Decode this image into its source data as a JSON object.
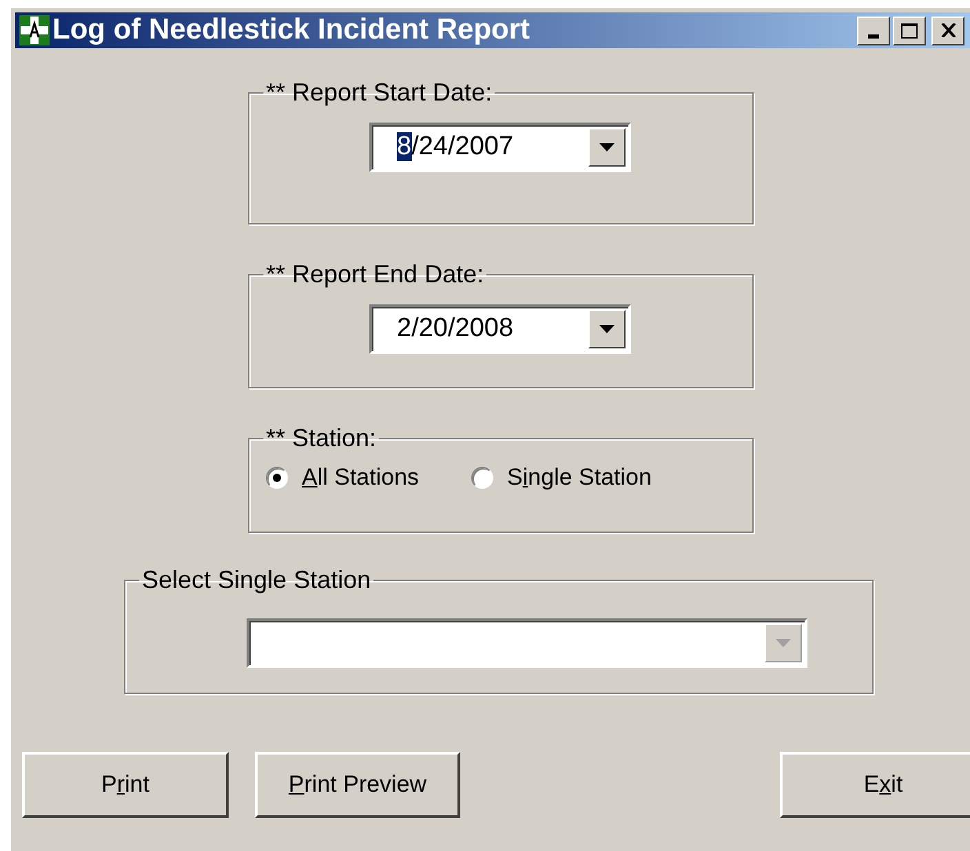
{
  "window": {
    "title": "Log of Needlestick Incident Report",
    "controls": [
      {
        "kind": "minimize"
      },
      {
        "kind": "maximize"
      },
      {
        "kind": "close"
      }
    ]
  },
  "start_date": {
    "label": "** Report Start Date:",
    "value": {
      "selected": "8",
      "rest": "/24/2007"
    }
  },
  "end_date": {
    "label": "** Report End Date:",
    "value": {
      "rest": "2/20/2008"
    }
  },
  "station": {
    "label": "** Station:",
    "options": [
      {
        "label": {
          "key": "A",
          "post": "ll Stations"
        },
        "selected": true
      },
      {
        "label": {
          "pre": "S",
          "key": "i",
          "post": "ngle Station"
        },
        "selected": false
      }
    ]
  },
  "single_station": {
    "label": "Select Single Station",
    "disabled": true
  },
  "buttons": [
    {
      "label": {
        "pre": "P",
        "key": "r",
        "post": "int"
      }
    },
    {
      "label": {
        "key": "P",
        "post": "rint Preview"
      }
    },
    {
      "label": {
        "pre": "E",
        "key": "x",
        "post": "it"
      }
    }
  ]
}
